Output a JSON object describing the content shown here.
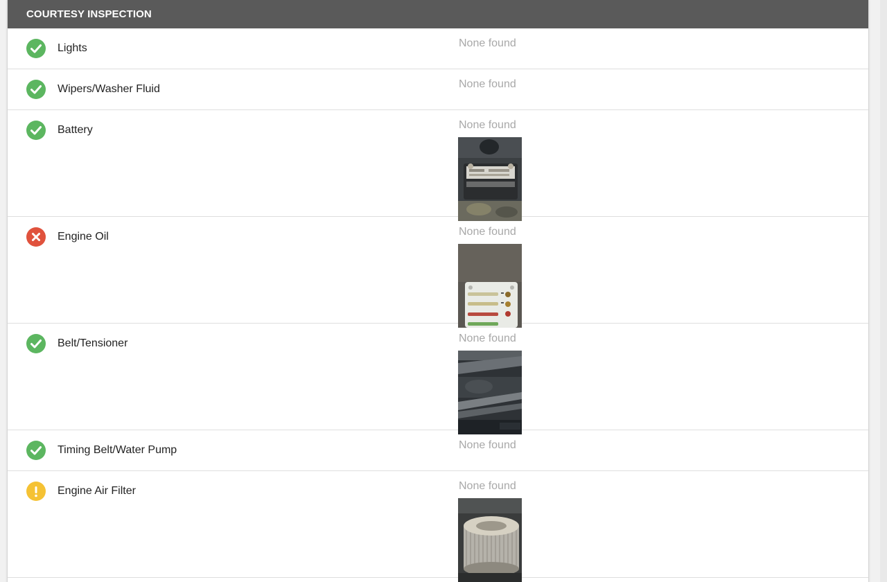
{
  "section": {
    "title": "COURTESY INSPECTION"
  },
  "items": [
    {
      "label": "Lights",
      "note": "None found",
      "status": "ok",
      "status_icon": "check-icon",
      "status_color": "#5cb660"
    },
    {
      "label": "Wipers/Washer Fluid",
      "note": "None found",
      "status": "ok",
      "status_icon": "check-icon",
      "status_color": "#5cb660"
    },
    {
      "label": "Battery",
      "note": "None found",
      "status": "ok",
      "status_icon": "check-icon",
      "status_color": "#5cb660",
      "photo": "battery-photo"
    },
    {
      "label": "Engine Oil",
      "note": "None found",
      "status": "fail",
      "status_icon": "x-icon",
      "status_color": "#e0523d",
      "photo": "engine-oil-dipstick-card-photo"
    },
    {
      "label": "Belt/Tensioner",
      "note": "None found",
      "status": "ok",
      "status_icon": "check-icon",
      "status_color": "#5cb660",
      "photo": "belt-photo"
    },
    {
      "label": "Timing Belt/Water Pump",
      "note": "None found",
      "status": "ok",
      "status_icon": "check-icon",
      "status_color": "#5cb660"
    },
    {
      "label": "Engine Air Filter",
      "note": "None found",
      "status": "warning",
      "status_icon": "exclamation-icon",
      "status_color": "#f5c234",
      "photo": "air-filter-photo"
    }
  ]
}
